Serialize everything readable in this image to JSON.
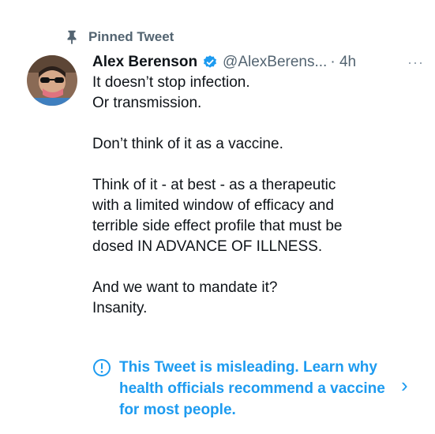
{
  "pinned_label": "Pinned Tweet",
  "author": {
    "name": "Alex Berenson",
    "handle": "@AlexBerens...",
    "time": "· 4h",
    "verified": true
  },
  "more_label": "···",
  "tweet_lines": [
    "It doesn’t stop infection.",
    "Or transmission.",
    "",
    "Don’t think of it as a vaccine.",
    "",
    "Think of it - at best - as a therapeutic",
    "with a limited window of efficacy and",
    "terrible side effect profile that must be",
    "dosed IN ADVANCE OF ILLNESS.",
    "",
    "And we want to mandate it?",
    "Insanity."
  ],
  "notice": {
    "icon": "exclamation-circle-icon",
    "text": "This Tweet is misleading. Learn why health officials recommend a vaccine for most people."
  },
  "icons": {
    "pin": "pin-icon",
    "verified": "verified-badge-icon",
    "chevron": "chevron-right-icon"
  },
  "colors": {
    "accent": "#1d9bf0",
    "secondary_text": "#536471"
  }
}
